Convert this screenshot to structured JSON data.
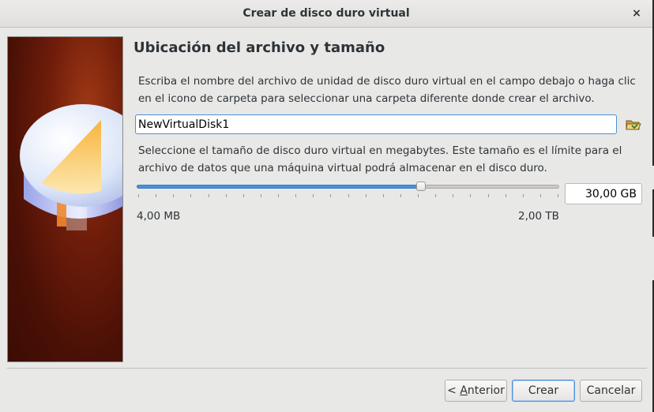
{
  "window": {
    "title": "Crear de disco duro virtual",
    "close_label": "×"
  },
  "page": {
    "heading": "Ubicación del archivo y tamaño",
    "location_description": "Escriba el nombre del archivo de unidad de disco duro virtual en el campo debajo o haga clic en el icono de carpeta para seleccionar una carpeta diferente donde crear el archivo.",
    "file_name": "NewVirtualDisk1",
    "size_description": "Seleccione el tamaño de disco duro virtual en megabytes. Este tamaño es el límite para el archivo de datos que una máquina virtual podrá almacenar en el disco duro.",
    "size_value": "30,00 GB",
    "slider_fraction": 0.672,
    "slider_tick_count": 25,
    "range_min": "4,00 MB",
    "range_max": "2,00 TB"
  },
  "buttons": {
    "back_prefix": "< ",
    "back_mnemonic": "A",
    "back_rest": "nterior",
    "create": "Crear",
    "cancel": "Cancelar"
  },
  "icons": {
    "folder": "folder-open-icon",
    "close": "close-icon"
  },
  "colors": {
    "accent": "#4a90d9",
    "banner_dark": "#3b0c04",
    "banner_light": "#a13a16"
  }
}
